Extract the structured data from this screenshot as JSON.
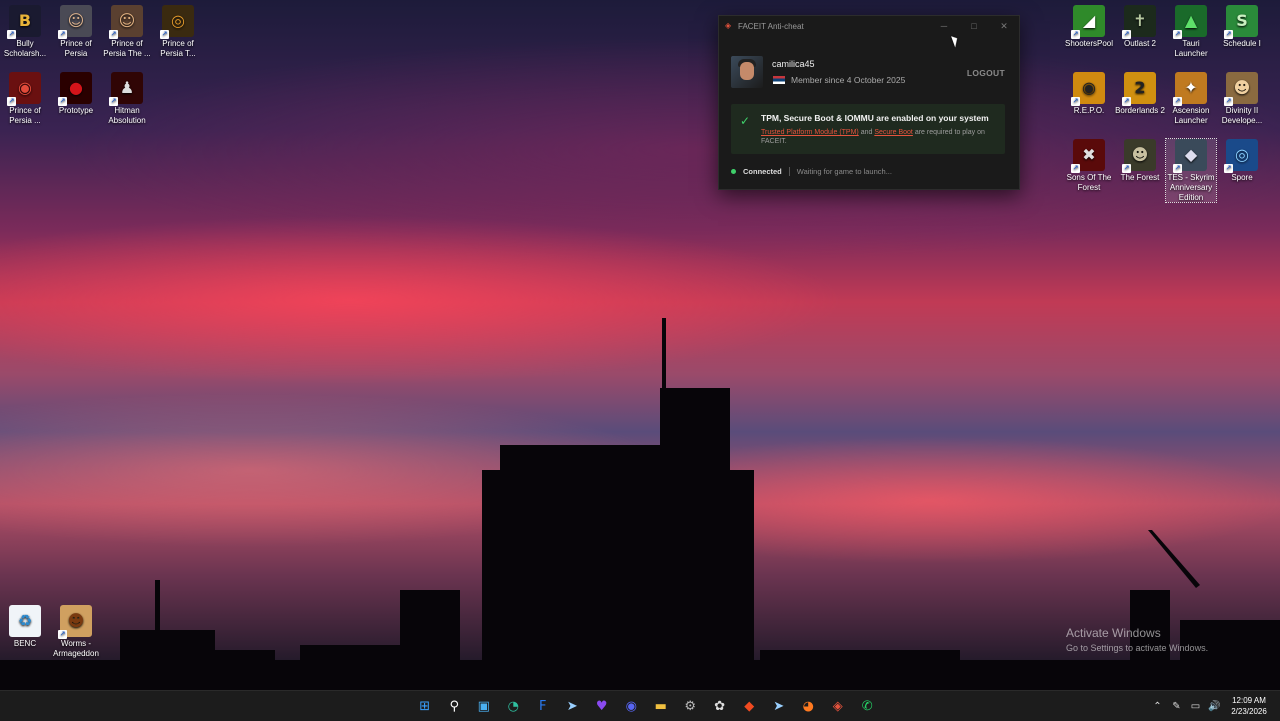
{
  "desktop_icons": [
    {
      "label": "Bully Scholarsh...",
      "bg": "#1a1a30",
      "glyph": "B",
      "fg": "#e8b33a"
    },
    {
      "label": "Prince of Persia",
      "bg": "#4a4a55",
      "glyph": "☺",
      "fg": "#d9b08c"
    },
    {
      "label": "Prince of Persia The ...",
      "bg": "#5a4030",
      "glyph": "☺",
      "fg": "#e0b080"
    },
    {
      "label": "Prince of Persia T...",
      "bg": "#3a2a10",
      "glyph": "◎",
      "fg": "#e39a2b"
    },
    {
      "label": "Prince of Persia ...",
      "bg": "#6a1010",
      "glyph": "◉",
      "fg": "#e04a3a"
    },
    {
      "label": "Prototype",
      "bg": "#2a0000",
      "glyph": "●",
      "fg": "#d4141a"
    },
    {
      "label": "Hitman Absolution",
      "bg": "#300505",
      "glyph": "♟",
      "fg": "#ddd"
    },
    {
      "label": "ShootersPool",
      "bg": "#2f8a2a",
      "glyph": "◢",
      "fg": "#fff"
    },
    {
      "label": "Outlast 2",
      "bg": "#1c2a1c",
      "glyph": "✝",
      "fg": "#b6c8a0"
    },
    {
      "label": "Tauri Launcher",
      "bg": "#1a6a2a",
      "glyph": "▲",
      "fg": "#5ee06a"
    },
    {
      "label": "Schedule I",
      "bg": "#2a8a3a",
      "glyph": "S",
      "fg": "#c9f0c0"
    },
    {
      "label": "R.E.P.O.",
      "bg": "#d08a10",
      "glyph": "◉",
      "fg": "#222"
    },
    {
      "label": "Borderlands 2",
      "bg": "#d09010",
      "glyph": "2",
      "fg": "#222"
    },
    {
      "label": "Ascension Launcher",
      "bg": "#c07a20",
      "glyph": "✦",
      "fg": "#fff"
    },
    {
      "label": "Divinity II Develope...",
      "bg": "#8a6a40",
      "glyph": "☻",
      "fg": "#f0d0a0"
    },
    {
      "label": "Sons Of The Forest",
      "bg": "#5a0a0a",
      "glyph": "✖",
      "fg": "#e0e0e0"
    },
    {
      "label": "The Forest",
      "bg": "#3a3a2a",
      "glyph": "☻",
      "fg": "#c8c0a0"
    },
    {
      "label": "TES - Skyrim Anniversary Edition",
      "bg": "#3a4a5a",
      "glyph": "◆",
      "fg": "#dde"
    },
    {
      "label": "Spore",
      "bg": "#1a4a8a",
      "glyph": "◎",
      "fg": "#8ad0ff"
    },
    {
      "label": "BENC",
      "bg": "#f0f4f8",
      "glyph": "♻",
      "fg": "#2a8ad0"
    },
    {
      "label": "Worms - Armageddon",
      "bg": "#d0a060",
      "glyph": "☻",
      "fg": "#7a3a10"
    }
  ],
  "faceit": {
    "title": "FACEIT Anti-cheat",
    "minimize": "─",
    "maximize": "□",
    "close": "✕",
    "username": "camilica45",
    "member_since": "Member since 4 October 2025",
    "logout": "LOGOUT",
    "alert_heading": "TPM, Secure Boot & IOMMU are enabled on your system",
    "alert_link_tpm": "Trusted Platform Module (TPM)",
    "alert_and": " and ",
    "alert_link_sb": "Secure Boot",
    "alert_tail": " are required to play on FACEIT.",
    "status_connected": "Connected",
    "status_waiting": "Waiting for game to launch..."
  },
  "watermark": {
    "line1": "Activate Windows",
    "line2": "Go to Settings to activate Windows."
  },
  "taskbar": {
    "apps": [
      {
        "name": "start",
        "glyph": "⊞",
        "color": "#3aa0ff"
      },
      {
        "name": "search",
        "glyph": "⚲",
        "color": "#fff"
      },
      {
        "name": "task-view",
        "glyph": "▣",
        "color": "#4ab0f0"
      },
      {
        "name": "edge",
        "glyph": "◔",
        "color": "#2fc0a0"
      },
      {
        "name": "facebook",
        "glyph": "F",
        "color": "#2a7af0"
      },
      {
        "name": "steam",
        "glyph": "➤",
        "color": "#9ad0ff"
      },
      {
        "name": "heart-app",
        "glyph": "♥",
        "color": "#8a4af0"
      },
      {
        "name": "discord",
        "glyph": "◉",
        "color": "#5865f2"
      },
      {
        "name": "file-explorer",
        "glyph": "▬",
        "color": "#f0c040"
      },
      {
        "name": "settings",
        "glyph": "⚙",
        "color": "#bbb"
      },
      {
        "name": "chatgpt",
        "glyph": "✿",
        "color": "#ddd"
      },
      {
        "name": "brave",
        "glyph": "◆",
        "color": "#f04a20"
      },
      {
        "name": "steam-2",
        "glyph": "➤",
        "color": "#9ad0ff"
      },
      {
        "name": "firefox",
        "glyph": "◕",
        "color": "#ff7a20"
      },
      {
        "name": "faceit-ac",
        "glyph": "◈",
        "color": "#e5533d"
      },
      {
        "name": "whatsapp",
        "glyph": "✆",
        "color": "#25d366"
      }
    ],
    "tray": [
      "⌃",
      "✎",
      "▭",
      "🔊"
    ],
    "time": "12:09 AM",
    "date": "2/23/2026"
  }
}
